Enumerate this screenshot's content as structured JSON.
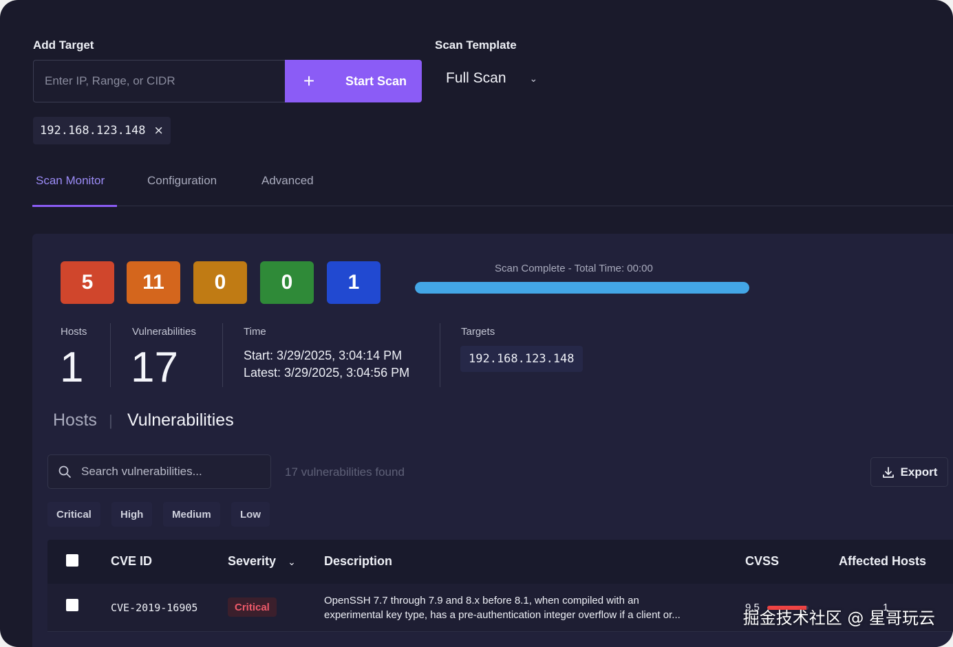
{
  "add_target": {
    "label": "Add Target",
    "placeholder": "Enter IP, Range, or CIDR",
    "start_label": "Start Scan",
    "plus_icon": "+"
  },
  "scan_template": {
    "label": "Scan Template",
    "value": "Full Scan",
    "chevron": "⌄"
  },
  "target_chip": {
    "value": "192.168.123.148",
    "remove": "×"
  },
  "tabs": [
    {
      "label": "Scan Monitor",
      "active": true
    },
    {
      "label": "Configuration",
      "active": false
    },
    {
      "label": "Advanced",
      "active": false
    }
  ],
  "severity_counts": [
    {
      "value": "5",
      "color": "#d0462c"
    },
    {
      "value": "11",
      "color": "#d4661d"
    },
    {
      "value": "0",
      "color": "#c07b14"
    },
    {
      "value": "0",
      "color": "#2f8a38"
    },
    {
      "value": "1",
      "color": "#2149d1"
    }
  ],
  "progress": {
    "text": "Scan Complete - Total Time: 00:00",
    "fraction": 1.0,
    "color": "#43a6e6"
  },
  "stats": {
    "hosts_label": "Hosts",
    "hosts_value": "1",
    "vulns_label": "Vulnerabilities",
    "vulns_value": "17",
    "time_label": "Time",
    "start": "Start: 3/29/2025, 3:04:14 PM",
    "latest": "Latest: 3/29/2025, 3:04:56 PM",
    "targets_label": "Targets",
    "target_value": "192.168.123.148"
  },
  "view_toggle": {
    "hosts": "Hosts",
    "separator": "|",
    "vulnerabilities": "Vulnerabilities"
  },
  "search": {
    "placeholder": "Search vulnerabilities...",
    "found": "17 vulnerabilities found"
  },
  "export_label": "Export",
  "filters": [
    "Critical",
    "High",
    "Medium",
    "Low"
  ],
  "table": {
    "headers": {
      "cve": "CVE ID",
      "severity": "Severity",
      "severity_chevron": "⌄",
      "description": "Description",
      "cvss": "CVSS",
      "hosts": "Affected Hosts"
    },
    "rows": [
      {
        "cve": "CVE-2019-16905",
        "severity": "Critical",
        "desc1": "OpenSSH 7.7 through 7.9 and 8.x before 8.1, when compiled with an",
        "desc2": "experimental key type, has a pre-authentication integer overflow if a client or...",
        "cvss": "9.5",
        "cvss_fraction": 0.95,
        "hosts": "1"
      }
    ]
  },
  "watermark": "掘金技术社区 @ 星哥玩云"
}
